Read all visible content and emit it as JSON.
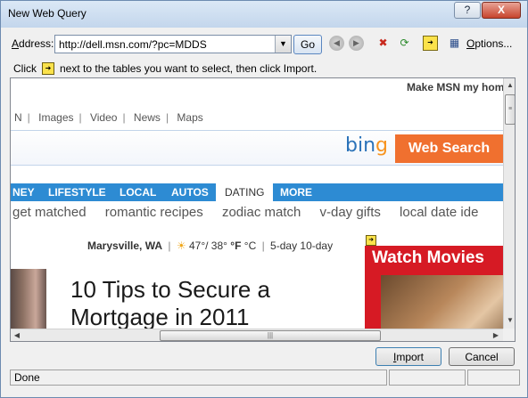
{
  "window": {
    "title": "New Web Query",
    "help_label": "?",
    "close_label": "X"
  },
  "toolbar": {
    "address_label_accel": "A",
    "address_label_rest": "ddress:",
    "address_value": "http://dell.msn.com/?pc=MDDS",
    "dropdown_glyph": "▼",
    "go_label": "Go",
    "back_glyph": "◀",
    "forward_glyph": "▶",
    "stop_glyph": "✖",
    "refresh_glyph": "⟳",
    "hide_icons_glyph": "➜",
    "options_glyph": "▦",
    "options_accel": "O",
    "options_rest": "ptions..."
  },
  "hint": {
    "before": "Click",
    "arrow_glyph": "➜",
    "after": "next to the tables you want to select, then click Import."
  },
  "page": {
    "make_home": "Make MSN my hom",
    "nav": [
      "N",
      "Images",
      "Video",
      "News",
      "Maps"
    ],
    "bing_part1": "bin",
    "bing_part2": "g",
    "web_search": "Web Search",
    "categories": [
      "NEY",
      "LIFESTYLE",
      "LOCAL",
      "AUTOS",
      "DATING",
      "MORE"
    ],
    "active_category": "DATING",
    "sub_links": [
      "get matched",
      "romantic recipes",
      "zodiac match",
      "v-day gifts",
      "local date ide"
    ],
    "weather": {
      "city": "Marysville, WA",
      "sun_glyph": "☀",
      "temps": "47°/ 38°",
      "unit_f": "°F",
      "unit_c": "°C",
      "forecast": "5-day 10-day"
    },
    "headline": "10 Tips to Secure a Mortgage in 2011",
    "ad_marker_glyph": "➜",
    "ad_title": "Watch Movies"
  },
  "scroll": {
    "up": "▲",
    "down": "▼",
    "left": "◀",
    "right": "▶",
    "grip": "≡",
    "hgrip": "|||"
  },
  "buttons": {
    "import_accel": "I",
    "import_rest": "mport",
    "cancel": "Cancel"
  },
  "status": {
    "text": "Done"
  }
}
